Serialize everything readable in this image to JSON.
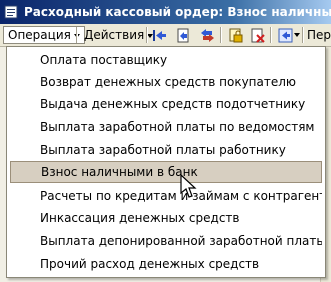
{
  "window": {
    "title": "Расходный кассовый ордер: Взнос наличными в ба"
  },
  "toolbar": {
    "operation_label": "Операция",
    "actions_label": "Действия",
    "next_label": "Пер"
  },
  "menu": {
    "items": [
      {
        "label": "Оплата поставщику"
      },
      {
        "label": "Возврат денежных средств покупателю"
      },
      {
        "label": "Выдача денежных средств подотчетнику"
      },
      {
        "label": "Выплата заработной платы по ведомостям"
      },
      {
        "label": "Выплата заработной платы работнику"
      },
      {
        "label": "Взнос наличными в банк",
        "highlighted": true
      },
      {
        "label": "Расчеты по кредитам и займам с контрагентами"
      },
      {
        "label": "Инкассация денежных средств"
      },
      {
        "label": "Выплата депонированной заработной платы"
      },
      {
        "label": "Прочий расход денежных средств"
      }
    ]
  },
  "colors": {
    "title_bar": "#0a246a",
    "highlight": "#d7cfc1"
  }
}
